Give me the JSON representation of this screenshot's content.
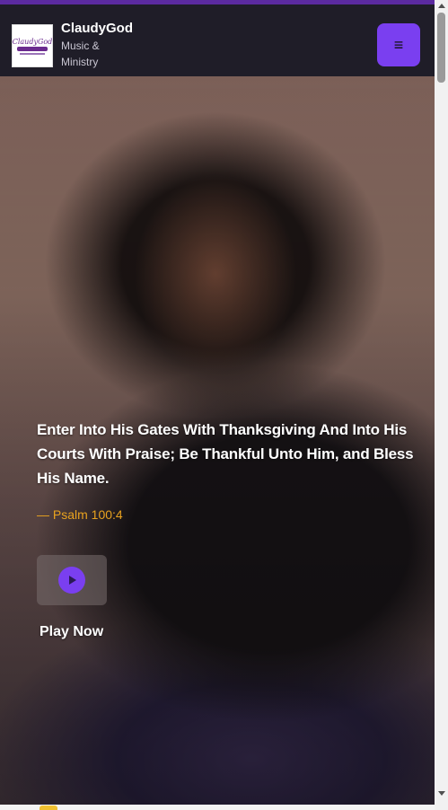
{
  "header": {
    "brand_name": "ClaudyGod",
    "brand_sub": "Music & Ministry",
    "logo_text": "ClaudyGod",
    "menu_icon": "hamburger-icon",
    "menu_symbol": "≡"
  },
  "hero": {
    "quote": "Enter Into His Gates With Thanksgiving And Into His Courts With Praise; Be Thankful Unto Him, and Bless His Name.",
    "citation": "— Psalm 100:4",
    "play_label": "Play Now",
    "play_icon": "play-circle-icon"
  },
  "colors": {
    "accent": "#7a3ff0",
    "citation": "#e8a21f",
    "header_bg": "#1f1d28",
    "top_strip": "#5b2aa0"
  }
}
